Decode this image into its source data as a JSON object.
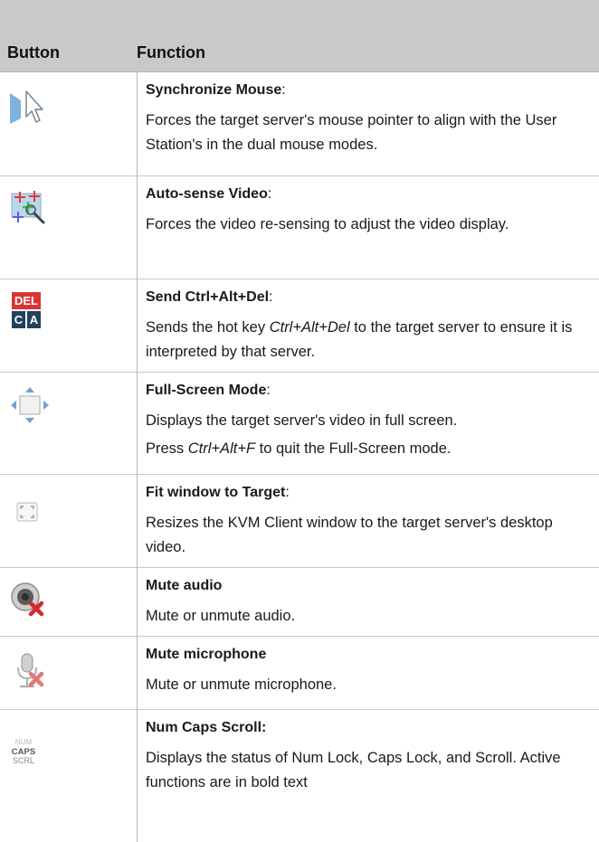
{
  "header": {
    "col_button": "Button",
    "col_function": "Function"
  },
  "rows": [
    {
      "icon": "sync-mouse-icon",
      "title": "Synchronize Mouse",
      "title_suffix": ":",
      "desc": "Forces the target server's mouse pointer to align with the User Station's in the dual mouse modes."
    },
    {
      "icon": "auto-sense-video-icon",
      "title": "Auto-sense Video",
      "title_suffix": ":",
      "desc": "Forces the video re-sensing to adjust the video display."
    },
    {
      "icon": "ctrl-alt-del-icon",
      "icon_text_top": "DEL",
      "icon_text_left": "C",
      "icon_text_right": "A",
      "title": "Send Ctrl+Alt+Del",
      "title_suffix": ":",
      "desc_pre": "Sends the hot key ",
      "desc_key": "Ctrl+Alt+Del",
      "desc_post": " to the target server to ensure it is interpreted by that server."
    },
    {
      "icon": "full-screen-icon",
      "title": "Full-Screen Mode",
      "title_suffix": ":",
      "desc": "Displays the target server's video in full screen.",
      "desc2_pre": "Press ",
      "desc2_key": "Ctrl+Alt+F",
      "desc2_post": " to quit the Full-Screen mode."
    },
    {
      "icon": "fit-window-icon",
      "title": "Fit window to Target",
      "title_suffix": ":",
      "desc": "Resizes the KVM Client window to the target server's desktop video."
    },
    {
      "icon": "mute-audio-icon",
      "title": "Mute audio",
      "desc": "Mute or unmute audio."
    },
    {
      "icon": "mute-microphone-icon",
      "title": "Mute microphone",
      "desc": "Mute or unmute microphone."
    },
    {
      "icon": "num-caps-scroll-icon",
      "icon_text_1": "NUM",
      "icon_text_2": "CAPS",
      "icon_text_3": "SCRL",
      "title": "Num Caps Scroll:",
      "desc": "Displays the status of Num Lock, Caps Lock, and Scroll. Active functions are in bold text"
    }
  ]
}
